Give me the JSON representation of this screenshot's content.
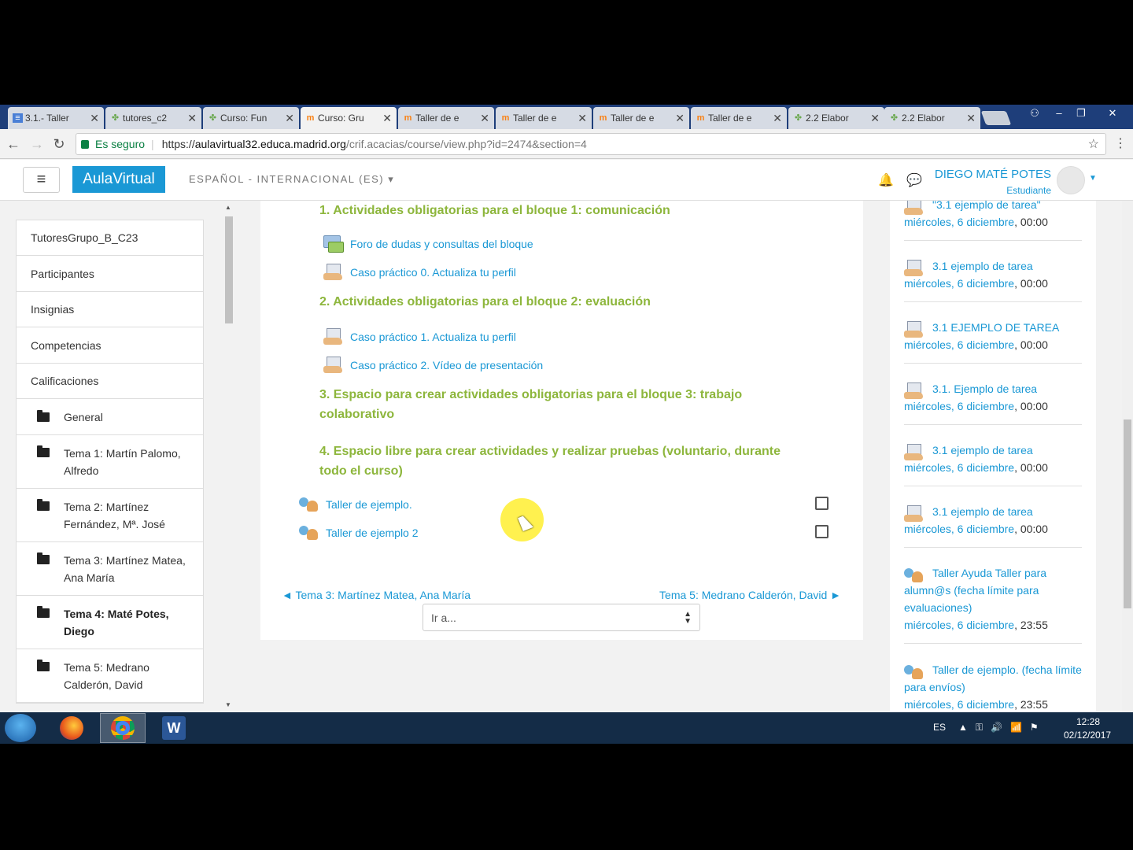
{
  "browser": {
    "tabs": [
      {
        "label": "3.1.- Taller",
        "favicon": "doc-icon"
      },
      {
        "label": "tutores_c2",
        "favicon": "leaf-icon"
      },
      {
        "label": "Curso: Fun",
        "favicon": "leaf-icon"
      },
      {
        "label": "Curso: Gru",
        "favicon": "moodle-icon"
      },
      {
        "label": "Taller de e",
        "favicon": "moodle-icon"
      },
      {
        "label": "Taller de e",
        "favicon": "moodle-icon"
      },
      {
        "label": "Taller de e",
        "favicon": "moodle-icon"
      },
      {
        "label": "Taller de e",
        "favicon": "moodle-icon"
      },
      {
        "label": "2.2 Elabor",
        "favicon": "leaf-icon"
      },
      {
        "label": "2.2 Elabor",
        "favicon": "leaf-icon"
      }
    ],
    "active_tab_index": 3,
    "secure_label": "Es seguro",
    "url_scheme": "https://",
    "url_host": "aulavirtual32.educa.madrid.org",
    "url_path": "/crif.acacias/course/view.php?id=2474&section=4"
  },
  "navbar": {
    "brand": "AulaVirtual",
    "language": "ESPAÑOL - INTERNACIONAL (ES)",
    "user_name": "DIEGO MATÉ POTES",
    "user_role": "Estudiante"
  },
  "drawer": {
    "items": [
      {
        "label": "TutoresGrupo_B_C23"
      },
      {
        "label": "Participantes"
      },
      {
        "label": "Insignias"
      },
      {
        "label": "Competencias"
      },
      {
        "label": "Calificaciones"
      }
    ],
    "sections": [
      {
        "label": "General"
      },
      {
        "label": "Tema 1: Martín Palomo, Alfredo"
      },
      {
        "label": "Tema 2: Martínez Fernández, Mª. José"
      },
      {
        "label": "Tema 3: Martínez Matea, Ana María"
      },
      {
        "label": "Tema 4: Maté Potes, Diego"
      },
      {
        "label": "Tema 5: Medrano Calderón, David"
      }
    ]
  },
  "main": {
    "headings": [
      "1. Actividades obligatorias para el bloque 1: comunicación",
      "2. Actividades obligatorias para el bloque 2: evaluación",
      "3. Espacio para crear actividades obligatorias para el bloque 3: trabajo colaborativo",
      "4. Espacio libre para crear actividades y realizar pruebas (voluntario, durante todo el curso)"
    ],
    "activities": [
      {
        "label": "Foro de dudas y consultas del bloque"
      },
      {
        "label": "Caso práctico 0. Actualiza tu perfil"
      },
      {
        "label": "Caso práctico 1. Actualiza tu perfil"
      },
      {
        "label": "Caso práctico 2. Vídeo de presentación"
      },
      {
        "label": "Taller de ejemplo."
      },
      {
        "label": "Taller de ejemplo 2"
      }
    ],
    "prev_section": "◄ Tema 3: Martínez Matea, Ana María",
    "next_section": "Tema 5: Medrano Calderón, David ►",
    "jump_to": "Ir a..."
  },
  "events": [
    {
      "name": "\"3.1 ejemplo de tarea\"",
      "date": "miércoles, 6 diciembre",
      "time": ", 00:00"
    },
    {
      "name": "3.1 ejemplo de tarea",
      "date": "miércoles, 6 diciembre",
      "time": ", 00:00"
    },
    {
      "name": "3.1 EJEMPLO DE TAREA",
      "date": "miércoles, 6 diciembre",
      "time": ", 00:00"
    },
    {
      "name": "3.1. Ejemplo de tarea",
      "date": "miércoles, 6 diciembre",
      "time": ", 00:00"
    },
    {
      "name": "3.1 ejemplo de tarea",
      "date": "miércoles, 6 diciembre",
      "time": ", 00:00"
    },
    {
      "name": "3.1 ejemplo de tarea",
      "date": "miércoles, 6 diciembre",
      "time": ", 00:00"
    },
    {
      "name": "Taller Ayuda Taller para alumn@s (fecha límite para evaluaciones)",
      "date": "miércoles, 6 diciembre",
      "time": ", 23:55"
    },
    {
      "name": "Taller de ejemplo. (fecha límite para envíos)",
      "date": "miércoles, 6 diciembre",
      "time": ", 23:55"
    }
  ],
  "taskbar": {
    "language": "ES",
    "time": "12:28",
    "date": "02/12/2017"
  },
  "colors": {
    "brand": "#1a98d5",
    "heading_green": "#8db63c",
    "link": "#1a98d5"
  }
}
